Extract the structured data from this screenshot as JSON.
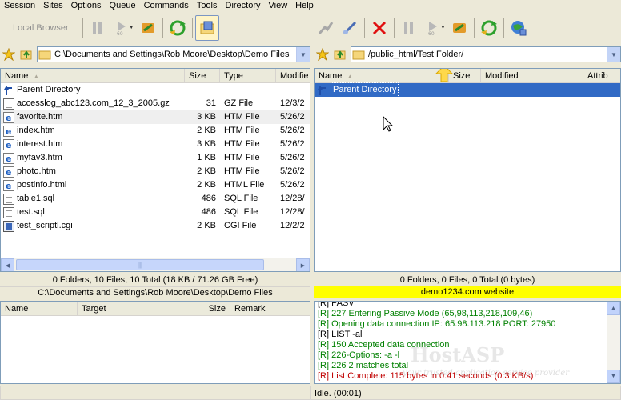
{
  "menu": [
    "Session",
    "Sites",
    "Options",
    "Queue",
    "Commands",
    "Tools",
    "Directory",
    "View",
    "Help"
  ],
  "left_toolbar": {
    "local_browser_label": "Local Browser"
  },
  "left_address": {
    "path": "C:\\Documents and Settings\\Rob Moore\\Desktop\\Demo Files"
  },
  "right_address": {
    "path": "/public_html/Test Folder/"
  },
  "left_columns": [
    "Name",
    "Size",
    "Type",
    "Modifie"
  ],
  "right_columns": [
    "Name",
    "Size",
    "Modified",
    "Attrib"
  ],
  "left_files": [
    {
      "name": "Parent Directory",
      "size": "",
      "type": "",
      "modified": "",
      "icon": "up-arrow-icon"
    },
    {
      "name": "accesslog_abc123.com_12_3_2005.gz",
      "size": "31",
      "type": "GZ File",
      "modified": "12/3/2",
      "icon": "file-icon"
    },
    {
      "name": "favorite.htm",
      "size": "3 KB",
      "type": "HTM File",
      "modified": "5/26/2",
      "icon": "html-file-icon"
    },
    {
      "name": "index.htm",
      "size": "2 KB",
      "type": "HTM File",
      "modified": "5/26/2",
      "icon": "html-file-icon"
    },
    {
      "name": "interest.htm",
      "size": "3 KB",
      "type": "HTM File",
      "modified": "5/26/2",
      "icon": "html-file-icon"
    },
    {
      "name": "myfav3.htm",
      "size": "1 KB",
      "type": "HTM File",
      "modified": "5/26/2",
      "icon": "html-file-icon"
    },
    {
      "name": "photo.htm",
      "size": "2 KB",
      "type": "HTM File",
      "modified": "5/26/2",
      "icon": "html-file-icon"
    },
    {
      "name": "postinfo.html",
      "size": "2 KB",
      "type": "HTML File",
      "modified": "5/26/2",
      "icon": "html-file-icon"
    },
    {
      "name": "table1.sql",
      "size": "486",
      "type": "SQL File",
      "modified": "12/28/",
      "icon": "text-file-icon"
    },
    {
      "name": "test.sql",
      "size": "486",
      "type": "SQL File",
      "modified": "12/28/",
      "icon": "text-file-icon"
    },
    {
      "name": "test_scriptl.cgi",
      "size": "2 KB",
      "type": "CGI File",
      "modified": "12/2/2",
      "icon": "cgi-file-icon"
    }
  ],
  "right_files": [
    {
      "name": "Parent Directory",
      "icon": "up-arrow-icon"
    }
  ],
  "left_status": "0 Folders, 10 Files, 10 Total (18 KB / 71.26 GB Free)",
  "left_path_status": "C:\\Documents and Settings\\Rob Moore\\Desktop\\Demo Files",
  "right_status": "0 Folders, 0 Files, 0 Total (0 bytes)",
  "right_site_status": "demo1234.com website",
  "queue_columns": [
    "Name",
    "Target",
    "Size",
    "Remark"
  ],
  "log": [
    {
      "text": "[R] PASV",
      "color": "#000000"
    },
    {
      "text": "[R] 227 Entering Passive Mode (65,98,113,218,109,46)",
      "color": "#008000"
    },
    {
      "text": "[R] Opening data connection IP: 65.98.113.218 PORT: 27950",
      "color": "#008000"
    },
    {
      "text": "[R] LIST -al",
      "color": "#000000"
    },
    {
      "text": "[R] 150 Accepted data connection",
      "color": "#008000"
    },
    {
      "text": "[R] 226-Options: -a -l",
      "color": "#008000"
    },
    {
      "text": "[R] 226 2 matches total",
      "color": "#008000"
    },
    {
      "text": "[R] List Complete: 115 bytes in 0.41 seconds (0.3 KB/s)",
      "color": "#c00000"
    }
  ],
  "watermark": {
    "brand": "HostASP",
    "tagline": "your trusted application service provider"
  },
  "bottom_status": "Idle. (00:01)"
}
